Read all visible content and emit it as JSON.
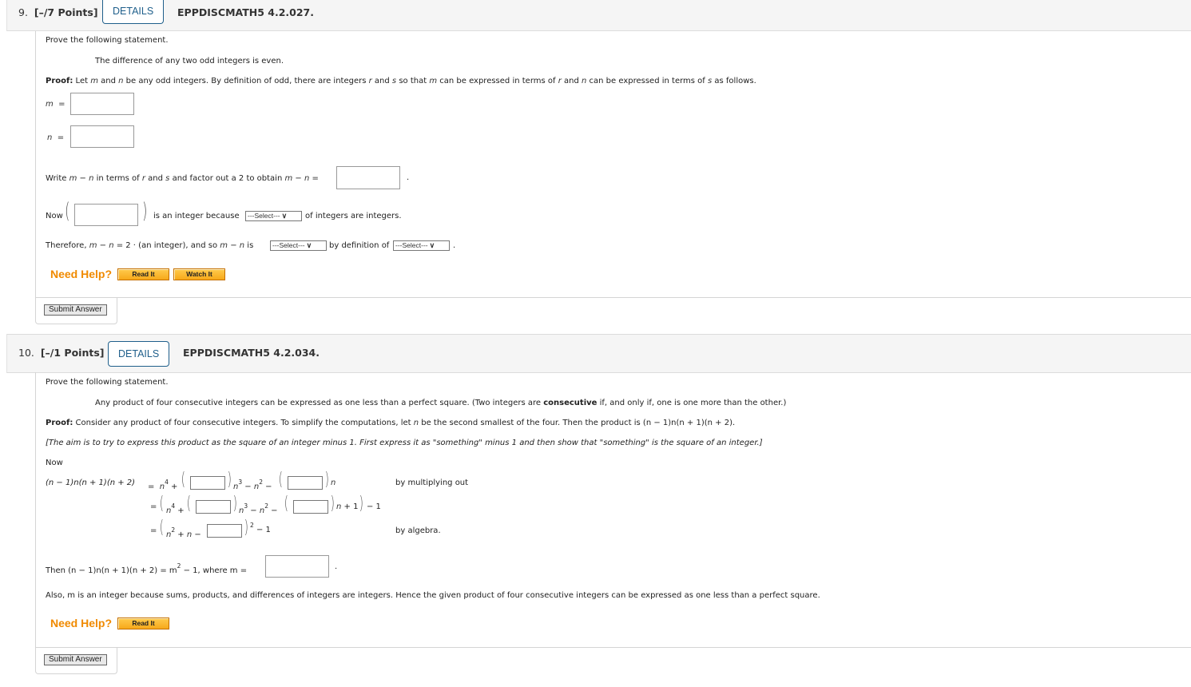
{
  "questions": [
    {
      "number": "9.",
      "points": "[–/7 Points]",
      "details_label": "DETAILS",
      "code": "EPPDISCMATH5 4.2.027.",
      "prompt": "Prove the following statement.",
      "statement": "The difference of any two odd integers is even.",
      "proof_label": "Proof:",
      "proof_parts": [
        "Let ",
        "m",
        " and ",
        "n",
        " be any odd integers. By definition of odd, there are integers ",
        "r",
        " and ",
        "s",
        " so that ",
        "m",
        " can be expressed in terms of ",
        "r",
        " and ",
        "n",
        " can be expressed in terms of ",
        "s",
        " as follows."
      ],
      "m_label": "m",
      "n_label": "n",
      "equals": "=",
      "inputs": {
        "m_value": "",
        "n_value": "",
        "m_minus_n_value": "",
        "now_value": ""
      },
      "write_parts": [
        "Write ",
        "m",
        " − ",
        "n",
        " in terms of ",
        "r",
        " and ",
        "s",
        " and factor out a 2 to obtain ",
        "m",
        " − ",
        "n",
        " ="
      ],
      "period": ".",
      "now_label": "Now",
      "now_mid": "is an integer because",
      "now_end": "of integers are integers.",
      "therefore_parts": [
        "Therefore, ",
        "m",
        " − ",
        "n",
        " = 2 · (an integer), and so ",
        "m",
        " − ",
        "n",
        " is"
      ],
      "by_def": "by definition of",
      "selects": [
        "---Select---",
        "---Select---",
        "---Select---"
      ],
      "need_help": "Need Help?",
      "help_buttons": [
        "Read It",
        "Watch It"
      ],
      "submit_label": "Submit Answer"
    },
    {
      "number": "10.",
      "points": "[–/1 Points]",
      "details_label": "DETAILS",
      "code": "EPPDISCMATH5 4.2.034.",
      "prompt": "Prove the following statement.",
      "statement_start": "Any product of four consecutive integers can be expressed as one less than a perfect square. (Two integers are ",
      "statement_bold": "consecutive",
      "statement_end": " if, and only if, one is one more than the other.)",
      "proof_label": "Proof:",
      "proof_text_a": " Consider any product of four consecutive integers. To simplify the computations, let ",
      "proof_var": "n",
      "proof_text_b": " be the second smallest of the four. Then the product is (",
      "proof_text_c": "n − 1)n(n + 1)(n + 2).",
      "hint": "[The aim is to try to express this product as the square of an integer minus 1. First express it as \"something\" minus 1 and then show that \"something\" is the square of an integer.]",
      "now_label": "Now",
      "lhs": "(n − 1)n(n + 1)(n + 2)",
      "eq_reason_1": "by multiplying out",
      "eq_reason_3": "by algebra.",
      "inputs": {
        "row1_a": "",
        "row1_b": "",
        "row2_a": "",
        "row2_b": "",
        "row3": "",
        "m_value": ""
      },
      "then_text": "Then (n − 1)n(n + 1)(n + 2) = m",
      "then_text_end": " − 1, where m =",
      "also_text": "Also, m is an integer because sums, products, and differences of integers are integers. Hence the given product of four consecutive integers can be expressed as one less than a perfect square.",
      "need_help": "Need Help?",
      "help_buttons": [
        "Read It"
      ],
      "submit_label": "Submit Answer"
    }
  ]
}
